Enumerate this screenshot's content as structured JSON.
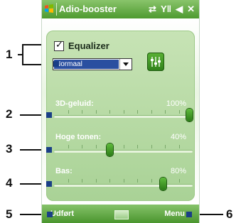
{
  "callouts": [
    "1",
    "2",
    "3",
    "4",
    "5",
    "6"
  ],
  "titlebar": {
    "title": "Adio-booster",
    "icons": [
      "windows-logo-icon",
      "connectivity-icon",
      "signal-icon",
      "speaker-icon",
      "close-icon"
    ]
  },
  "equalizer": {
    "checkbox_label": "Equalizer",
    "checked": true,
    "preset_value": "Normaal",
    "settings_icon": "equalizer-settings-icon"
  },
  "sliders": [
    {
      "label": "3D-geluid:",
      "value_text": "100%",
      "value": 1.0
    },
    {
      "label": "Hoge tonen:",
      "value_text": "40%",
      "value": 0.4
    },
    {
      "label": "Bas:",
      "value_text": "80%",
      "value": 0.8
    }
  ],
  "menubar": {
    "left_label": "Udført",
    "right_label": "Menu",
    "keyboard_icon": "keyboard-icon"
  },
  "colors": {
    "bar_green": "#4e9a2f",
    "panel_green": "#b6d9a3",
    "select_highlight": "#2a4fa0",
    "callout_marker": "#1a3f86"
  }
}
